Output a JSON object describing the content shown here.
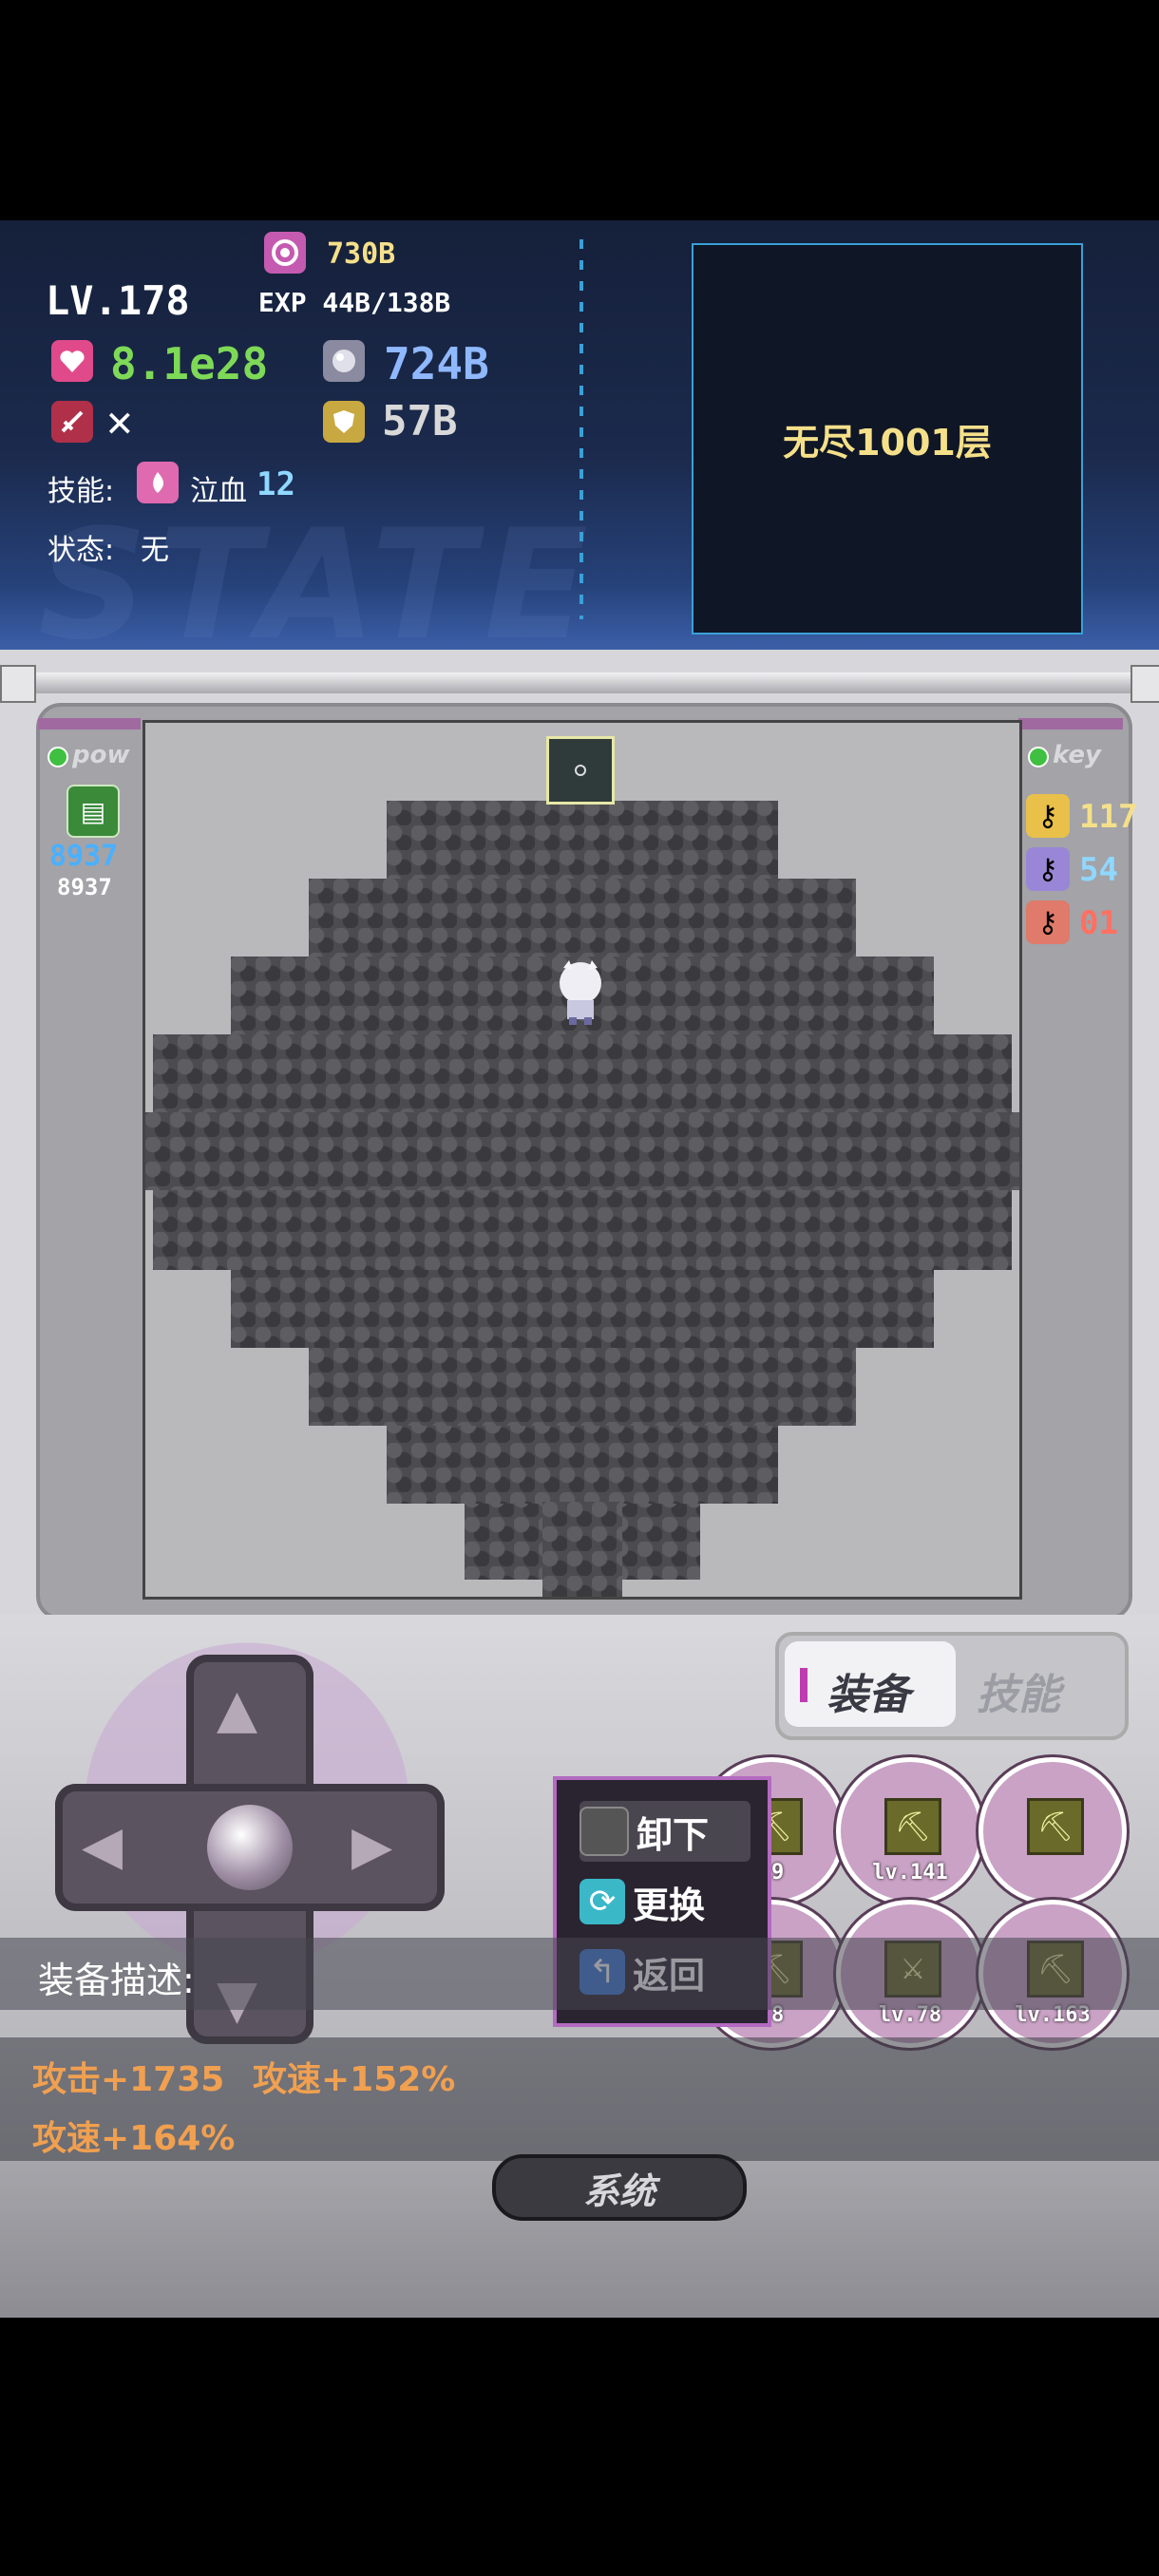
{
  "hud": {
    "level": "LV.178",
    "gold": "730B",
    "exp": "EXP 44B/138B",
    "hp": "8.1e28",
    "defense_val": "724B",
    "attack_status": "✕",
    "magic_def": "57B",
    "skill_label": "技能:",
    "skill_name": "泣血",
    "skill_level": "12",
    "state_label": "状态:",
    "state_value": "无",
    "floor": "无尽1001层"
  },
  "left_panel": {
    "title": "pow",
    "value1": "8937",
    "value2": "8937"
  },
  "right_panel": {
    "title": "key",
    "keys": [
      {
        "count": "117",
        "color": "#e8c04a"
      },
      {
        "count": "54",
        "color": "#9a86d6"
      },
      {
        "count": "01",
        "color": "#e07a6a"
      }
    ]
  },
  "tabs": {
    "equip": "装备",
    "skill": "技能"
  },
  "equipment": [
    {
      "lv": "29",
      "name": "slot-1"
    },
    {
      "lv": "lv.141",
      "name": "slot-2"
    },
    {
      "lv": "",
      "name": "slot-3"
    },
    {
      "lv": "08",
      "name": "slot-4"
    },
    {
      "lv": "lv.78",
      "name": "slot-5"
    },
    {
      "lv": "lv.163",
      "name": "slot-6"
    }
  ],
  "menu": {
    "unequip": "卸下",
    "replace": "更换",
    "back": "返回"
  },
  "description": {
    "label": "装备描述:",
    "line1a": "攻击+1735",
    "line1b": "攻速+152%",
    "line2": "攻速+164%"
  },
  "system_button": "系统",
  "colors": {
    "accent_blue": "#3aa0d8",
    "hp_green": "#7ed957",
    "def_blue": "#8fb8ff",
    "gold_yellow": "#f5e08a",
    "attr_orange": "#f0a050"
  }
}
